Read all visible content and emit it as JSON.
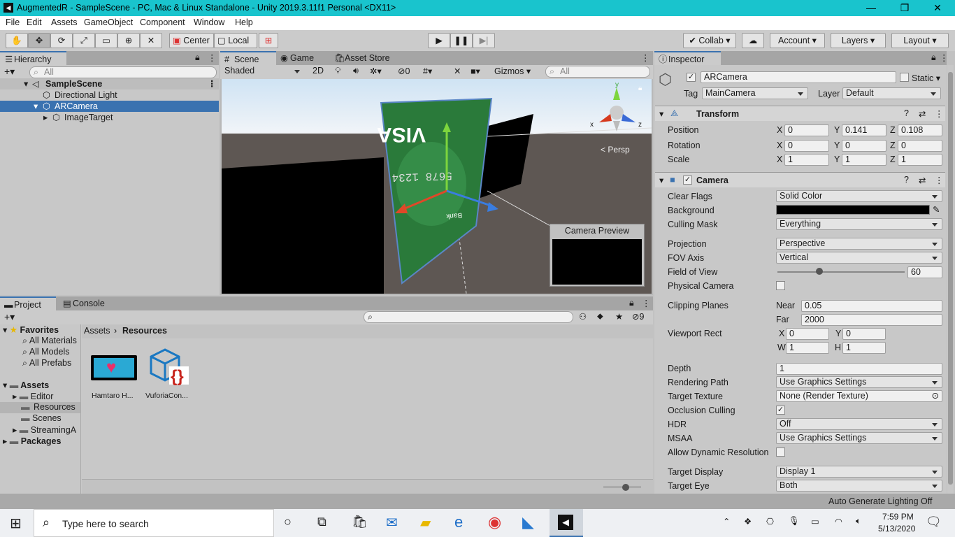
{
  "window": {
    "title": "AugmentedR - SampleScene - PC, Mac & Linux Standalone - Unity 2019.3.11f1 Personal <DX11>"
  },
  "menu": [
    "File",
    "Edit",
    "Assets",
    "GameObject",
    "Component",
    "Window",
    "Help"
  ],
  "toolbar": {
    "center": "Center",
    "local": "Local",
    "collab": "Collab",
    "account": "Account",
    "layers": "Layers",
    "layout": "Layout"
  },
  "hierarchy": {
    "tab": "Hierarchy",
    "search_placeholder": "All",
    "items": [
      {
        "label": "SampleScene"
      },
      {
        "label": "Directional Light"
      },
      {
        "label": "ARCamera"
      },
      {
        "label": "ImageTarget"
      }
    ]
  },
  "scene": {
    "tabs": [
      "Scene",
      "Game",
      "Asset Store"
    ],
    "shading": "Shaded",
    "mode2d": "2D",
    "hidden_count": "0",
    "gizmos": "Gizmos",
    "search_placeholder": "All",
    "persp": "Persp",
    "preview_title": "Camera Preview",
    "axis_x": "x",
    "axis_y": "y",
    "axis_z": "z",
    "card_brand": "VISA",
    "card_number": "5678 1234",
    "card_bank": "Bank"
  },
  "project": {
    "tabs": [
      "Project",
      "Console"
    ],
    "breadcrumb": [
      "Assets",
      "Resources"
    ],
    "hidden_count": "9",
    "tree": [
      {
        "label": "Favorites"
      },
      {
        "label": "All Materials"
      },
      {
        "label": "All Models"
      },
      {
        "label": "All Prefabs"
      },
      {
        "label": "Assets"
      },
      {
        "label": "Editor"
      },
      {
        "label": "Resources"
      },
      {
        "label": "Scenes"
      },
      {
        "label": "StreamingA"
      },
      {
        "label": "Packages"
      }
    ],
    "assets": [
      {
        "label": "Hamtaro H..."
      },
      {
        "label": "VuforiaCon..."
      }
    ]
  },
  "inspector": {
    "tab": "Inspector",
    "name": "ARCamera",
    "static": "Static",
    "tag_label": "Tag",
    "tag": "MainCamera",
    "layer_label": "Layer",
    "layer": "Default",
    "transform": {
      "title": "Transform",
      "rows": [
        {
          "label": "Position",
          "x": "0",
          "y": "0.141",
          "z": "0.108"
        },
        {
          "label": "Rotation",
          "x": "0",
          "y": "0",
          "z": "0"
        },
        {
          "label": "Scale",
          "x": "1",
          "y": "1",
          "z": "1"
        }
      ]
    },
    "camera": {
      "title": "Camera",
      "clear_flags": "Solid Color",
      "culling_mask": "Everything",
      "projection": "Perspective",
      "fov_axis": "Vertical",
      "fov": "60",
      "near": "0.05",
      "far": "2000",
      "vp_x": "0",
      "vp_y": "0",
      "vp_w": "1",
      "vp_h": "1",
      "depth": "1",
      "rendering_path": "Use Graphics Settings",
      "target_texture": "None (Render Texture)",
      "hdr": "Off",
      "msaa": "Use Graphics Settings",
      "target_display": "Display 1",
      "target_eye": "Both",
      "labels": {
        "clear_flags": "Clear Flags",
        "background": "Background",
        "culling_mask": "Culling Mask",
        "projection": "Projection",
        "fov_axis": "FOV Axis",
        "fov": "Field of View",
        "physical": "Physical Camera",
        "clipping": "Clipping Planes",
        "near": "Near",
        "far": "Far",
        "viewport": "Viewport Rect",
        "depth": "Depth",
        "rendering_path": "Rendering Path",
        "target_texture": "Target Texture",
        "occlusion": "Occlusion Culling",
        "hdr": "HDR",
        "msaa": "MSAA",
        "dynres": "Allow Dynamic Resolution",
        "target_display": "Target Display",
        "target_eye": "Target Eye"
      }
    }
  },
  "status": {
    "lighting": "Auto Generate Lighting Off"
  },
  "taskbar": {
    "search_placeholder": "Type here to search",
    "time": "7:59 PM",
    "date": "5/13/2020"
  },
  "colors": {
    "accent": "#3a72b0",
    "titlebar": "#19c4cd",
    "selection": "#3a72b0"
  }
}
